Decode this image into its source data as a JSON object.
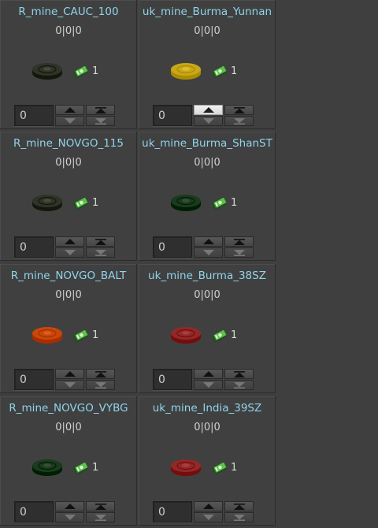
{
  "cards": [
    {
      "name": "R_mine_CAUC_100",
      "counts": "0|0|0",
      "cost": "1",
      "quantity": "0",
      "mine_color": "#2f3328",
      "highlight_up": false
    },
    {
      "name": "uk_mine_Burma_Yunnan",
      "counts": "0|0|0",
      "cost": "1",
      "quantity": "0",
      "mine_color": "#c8a818",
      "highlight_up": true
    },
    {
      "name": "R_mine_NOVGO_115",
      "counts": "0|0|0",
      "cost": "1",
      "quantity": "0",
      "mine_color": "#2f3328",
      "highlight_up": false
    },
    {
      "name": "uk_mine_Burma_ShanST",
      "counts": "0|0|0",
      "cost": "1",
      "quantity": "0",
      "mine_color": "#1c3a1e",
      "highlight_up": false
    },
    {
      "name": "R_mine_NOVGO_BALT",
      "counts": "0|0|0",
      "cost": "1",
      "quantity": "0",
      "mine_color": "#c8480a",
      "highlight_up": false
    },
    {
      "name": "uk_mine_Burma_38SZ",
      "counts": "0|0|0",
      "cost": "1",
      "quantity": "0",
      "mine_color": "#922828",
      "highlight_up": false
    },
    {
      "name": "R_mine_NOVGO_VYBG",
      "counts": "0|0|0",
      "cost": "1",
      "quantity": "0",
      "mine_color": "#1c3a1e",
      "highlight_up": false
    },
    {
      "name": "uk_mine_India_39SZ",
      "counts": "0|0|0",
      "cost": "1",
      "quantity": "0",
      "mine_color": "#922828",
      "highlight_up": false
    }
  ],
  "icons": {
    "mine": "mine-icon",
    "cost": "money-icon",
    "up": "arrow-up-icon",
    "down": "arrow-down-icon",
    "max": "arrow-max-icon",
    "min": "arrow-min-icon"
  },
  "colors": {
    "name_text": "#8fd4ec",
    "background": "#404040"
  }
}
